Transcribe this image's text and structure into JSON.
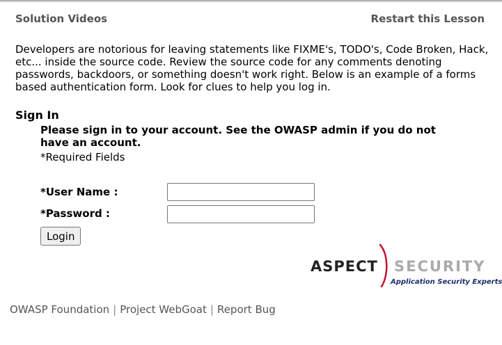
{
  "lesson_nav": {
    "solution_videos": "Solution Videos",
    "restart_lesson": "Restart this Lesson"
  },
  "intro_text": "Developers are notorious for leaving statements like FIXME's, TODO's, Code Broken, Hack, etc... inside the source code.  Review the source code for any comments denoting passwords, backdoors, or something doesn't work right.  Below is an example of a forms based authentication form. Look for clues to help you log in.",
  "signin": {
    "heading": "Sign In",
    "instructions": "Please sign in to your account. See the OWASP admin if you do not have an account.",
    "required_note": "*Required Fields",
    "username_label": "*User Name :",
    "username_value": "",
    "password_label": "*Password :",
    "password_value": "",
    "login_button": "Login"
  },
  "logo": {
    "name_part1": "ASPECT",
    "name_part2": "SECURITY",
    "tagline": "Application Security Experts",
    "accent_color": "#c8102e"
  },
  "footer": {
    "links": [
      "OWASP Foundation",
      "Project WebGoat",
      "Report Bug"
    ],
    "separator": "|"
  }
}
